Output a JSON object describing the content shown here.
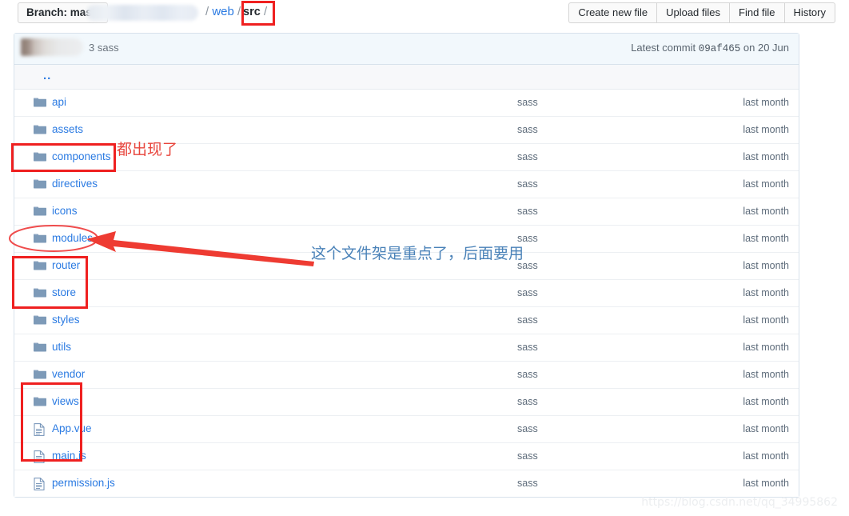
{
  "topbar": {
    "branch_label": "Branch: mast",
    "breadcrumb": {
      "sep1": "/",
      "web": "web",
      "sep2": "/",
      "src": "src",
      "sep3": "/"
    },
    "buttons": [
      {
        "label": "Create new file",
        "name": "create-new-file-button"
      },
      {
        "label": "Upload files",
        "name": "upload-files-button"
      },
      {
        "label": "Find file",
        "name": "find-file-button"
      },
      {
        "label": "History",
        "name": "history-button"
      }
    ]
  },
  "commit": {
    "message": "3 sass",
    "latest_prefix": "Latest commit",
    "sha": "09af465",
    "date_suffix": "on 20 Jun"
  },
  "files": {
    "up_dir": "..",
    "rows": [
      {
        "name": "api",
        "type": "folder",
        "message": "sass",
        "time": "last month"
      },
      {
        "name": "assets",
        "type": "folder",
        "message": "sass",
        "time": "last month"
      },
      {
        "name": "components",
        "type": "folder",
        "message": "sass",
        "time": "last month"
      },
      {
        "name": "directives",
        "type": "folder",
        "message": "sass",
        "time": "last month"
      },
      {
        "name": "icons",
        "type": "folder",
        "message": "sass",
        "time": "last month"
      },
      {
        "name": "modules",
        "type": "folder",
        "message": "sass",
        "time": "last month"
      },
      {
        "name": "router",
        "type": "folder",
        "message": "sass",
        "time": "last month"
      },
      {
        "name": "store",
        "type": "folder",
        "message": "sass",
        "time": "last month"
      },
      {
        "name": "styles",
        "type": "folder",
        "message": "sass",
        "time": "last month"
      },
      {
        "name": "utils",
        "type": "folder",
        "message": "sass",
        "time": "last month"
      },
      {
        "name": "vendor",
        "type": "folder",
        "message": "sass",
        "time": "last month"
      },
      {
        "name": "views",
        "type": "folder",
        "message": "sass",
        "time": "last month"
      },
      {
        "name": "App.vue",
        "type": "file",
        "message": "sass",
        "time": "last month"
      },
      {
        "name": "main.js",
        "type": "file",
        "message": "sass",
        "time": "last month"
      },
      {
        "name": "permission.js",
        "type": "file",
        "message": "sass",
        "time": "last month"
      }
    ]
  },
  "annotations": {
    "note_red": "都出现了",
    "note_blue": "这个文件架是重点了，后面要用",
    "colors": {
      "red": "#ef2020",
      "red_text": "#e8453c",
      "blue_text": "#4a82b8",
      "link": "#2a7ae2",
      "folder_icon": "#7d9ab8"
    }
  },
  "watermark": "https://blog.csdn.net/qq_34995862"
}
